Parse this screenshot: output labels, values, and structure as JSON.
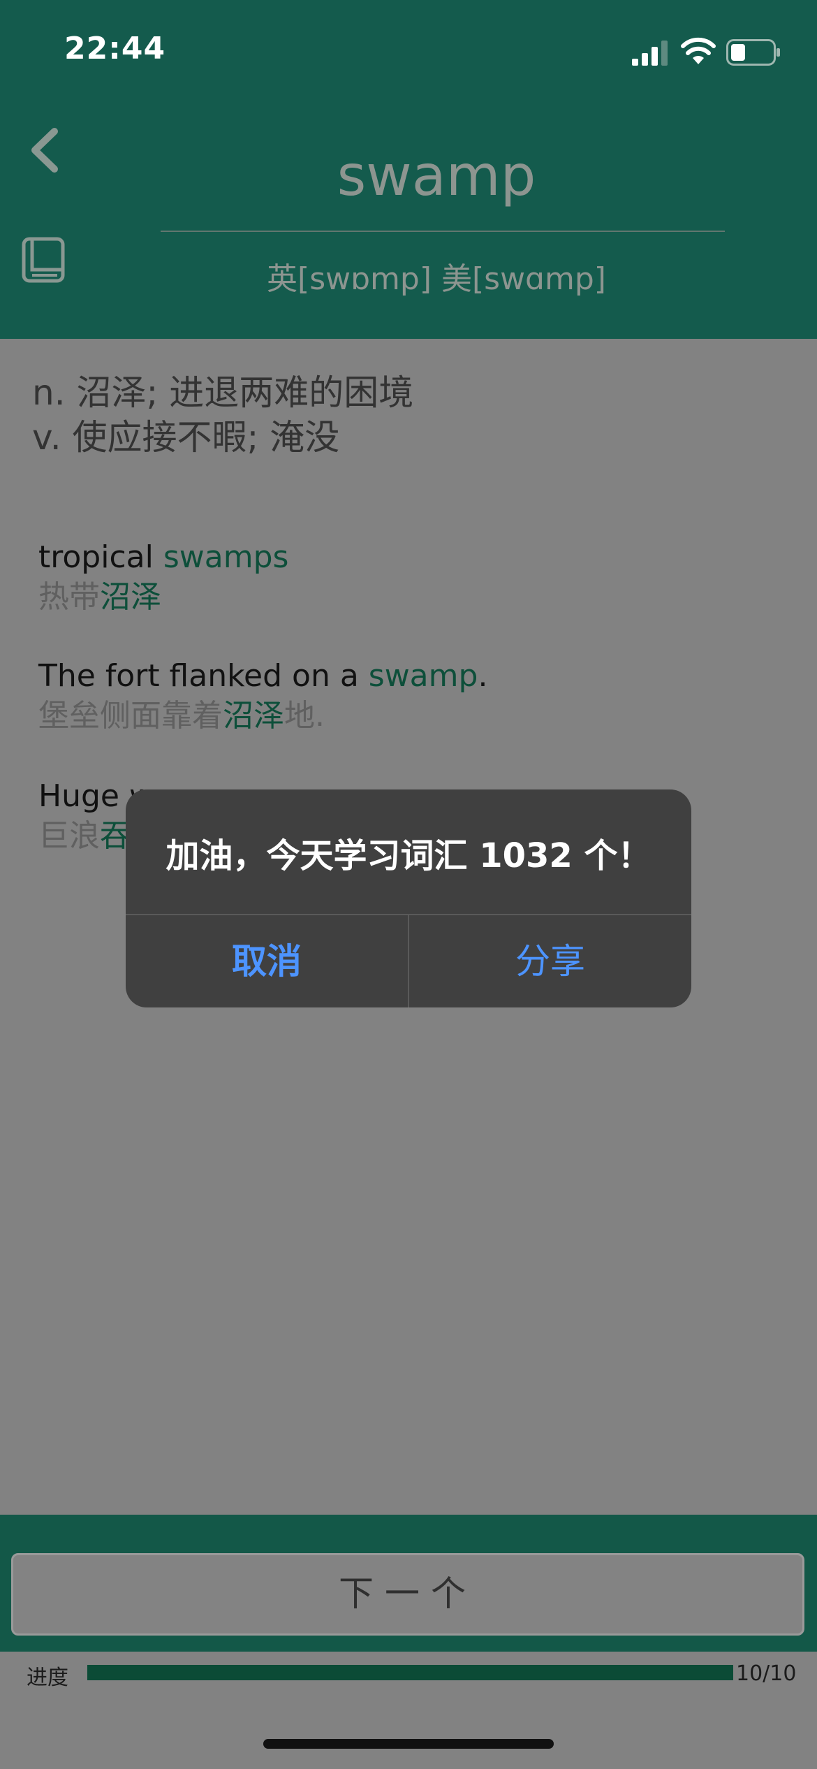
{
  "status_bar": {
    "time": "22:44"
  },
  "header": {
    "word": "swamp",
    "phonetic": "英[swɒmp]  美[swɑmp]"
  },
  "definitions": [
    "n. 沼泽; 进退两难的困境",
    "v. 使应接不暇; 淹没"
  ],
  "examples": [
    {
      "en_pre": "tropical ",
      "en_hl": "swamps",
      "en_post": "",
      "cn_pre": "热带",
      "cn_hl": "沼泽",
      "cn_post": ""
    },
    {
      "en_pre": "The fort flanked on a ",
      "en_hl": "swamp",
      "en_post": ".",
      "cn_pre": "堡垒侧面靠着",
      "cn_hl": "沼泽",
      "cn_post": "地."
    },
    {
      "en_pre": "Huge w",
      "en_hl": "",
      "en_post": "",
      "cn_pre": "巨浪",
      "cn_hl": "吞",
      "cn_post": ""
    }
  ],
  "alert": {
    "message": "加油，今天学习词汇 1032 个！",
    "cancel_label": "取消",
    "share_label": "分享"
  },
  "bottom": {
    "next_label": "下一个",
    "progress_label": "进度",
    "progress_count": "10/10",
    "progress_fraction": 1.0
  },
  "colors": {
    "header_bg": "#145b4d",
    "highlight": "#0d4f3a",
    "alert_button": "#4d94ff"
  }
}
